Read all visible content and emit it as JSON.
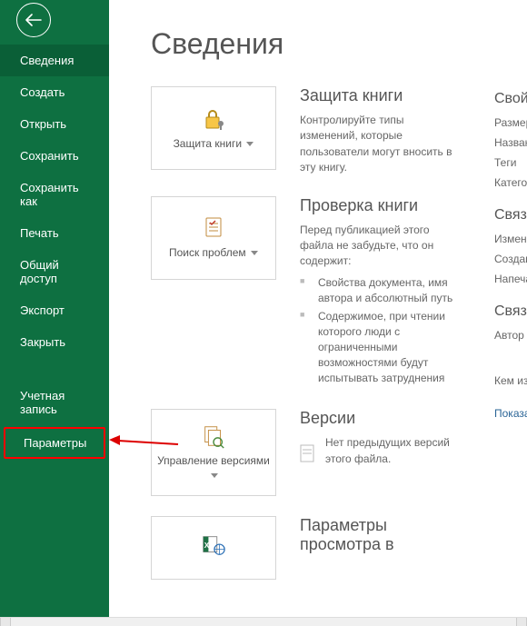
{
  "page_title": "Сведения",
  "menu": {
    "items": [
      "Сведения",
      "Создать",
      "Открыть",
      "Сохранить",
      "Сохранить как",
      "Печать",
      "Общий доступ",
      "Экспорт",
      "Закрыть"
    ],
    "account": "Учетная запись",
    "options": "Параметры"
  },
  "protect": {
    "tile": "Защита книги",
    "title": "Защита книги",
    "desc": "Контролируйте типы изменений, которые пользователи могут вносить в эту книгу."
  },
  "inspect": {
    "tile": "Поиск проблем",
    "title": "Проверка книги",
    "desc": "Перед публикацией этого файла не забудьте, что он содержит:",
    "bullets": [
      "Свойства документа, имя автора и абсолютный путь",
      "Содержимое, при чтении которого люди с ограниченными возможностями будут испытывать затруднения"
    ]
  },
  "versions": {
    "tile": "Управление версиями",
    "title": "Версии",
    "desc": "Нет предыдущих версий этого файла."
  },
  "browser": {
    "title": "Параметры просмотра в"
  },
  "props": {
    "h1": "Свойства",
    "size": "Размер",
    "name": "Название",
    "tags": "Теги",
    "cat": "Категории",
    "h2": "Связанные даты",
    "mod": "Изменен",
    "created": "Создан",
    "printed": "Напечатан",
    "h3": "Связанные пользователи",
    "author": "Автор",
    "who": "Кем изменен",
    "show": "Показать все"
  }
}
